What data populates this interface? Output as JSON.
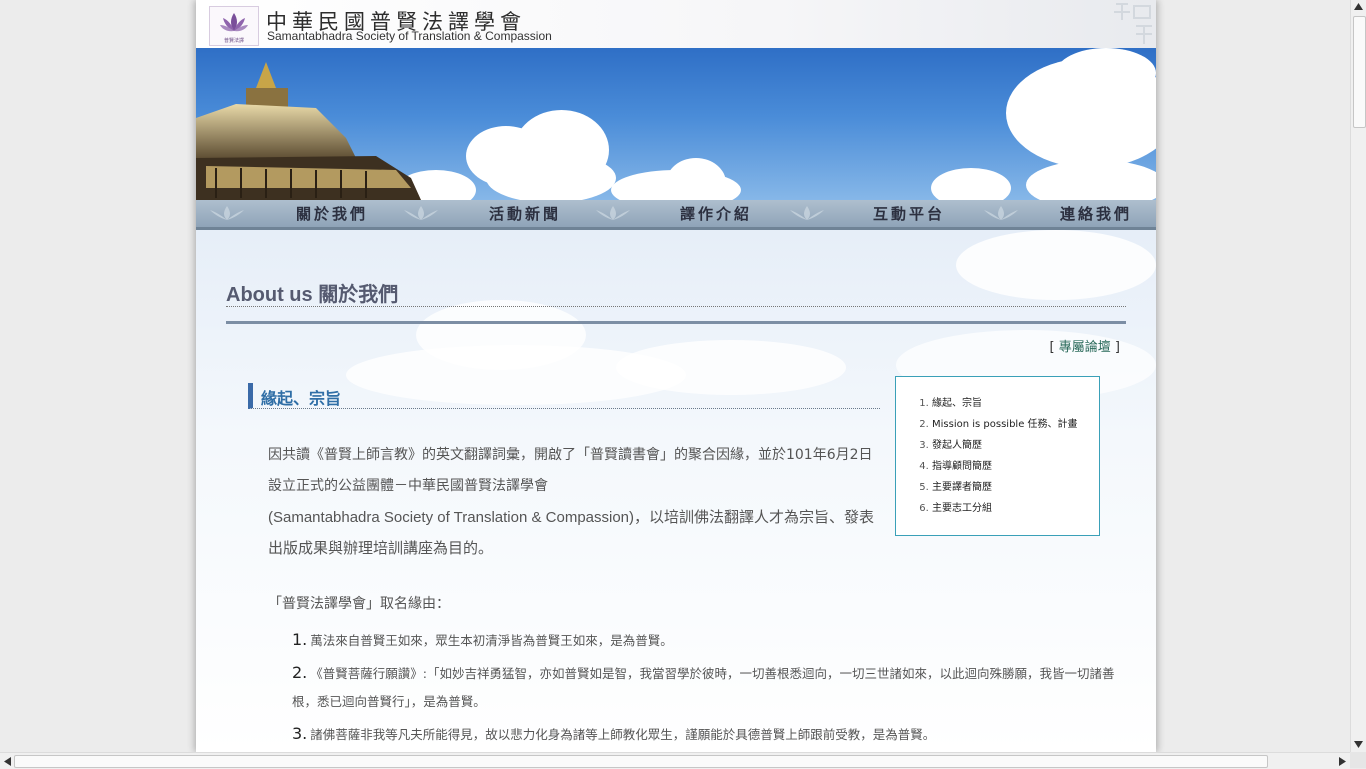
{
  "header": {
    "title_zh": "中華民國普賢法譯學會",
    "title_en": "Samantabhadra Society of Translation & Compassion",
    "logo_caption": "普賢法譯"
  },
  "nav": {
    "items": [
      "關於我們",
      "活動新聞",
      "譯作介紹",
      "互動平台",
      "連絡我們"
    ]
  },
  "page": {
    "title": "About us 關於我們",
    "forum_open": "[",
    "forum_label": "專屬論壇",
    "forum_close": "]"
  },
  "toc": {
    "items": [
      "緣起、宗旨",
      "Mission is possible 任務、計畫",
      "發起人簡歷",
      "指導顧問簡歷",
      "主要譯者簡歷",
      "主要志工分組"
    ]
  },
  "section": {
    "title": "緣起、宗旨",
    "para1": "因共讀《普賢上師言教》的英文翻譯詞彙，開啟了「普賢讀書會」的聚合因緣，並於101年6月2日設立正式的公益團體－中華民國普賢法譯學會",
    "para2": "(Samantabhadra Society of Translation & Compassion)，以培訓佛法翻譯人才為宗旨、發表出版成果與辦理培訓講座為目的。",
    "naming_intro": "「普賢法譯學會」取名緣由：",
    "reasons": [
      {
        "num": "1.",
        "text": "萬法來自普賢王如來，眾生本初清淨皆為普賢王如來，是為普賢。"
      },
      {
        "num": "2.",
        "text": "《普賢菩薩行願讚》:「如妙吉祥勇猛智，亦如普賢如是智，我當習學於彼時，一切善根悉迴向，一切三世諸如來，以此迴向殊勝願，我皆一切諸善根，悉已迴向普賢行」，是為普賢。"
      },
      {
        "num": "3.",
        "text": "諸佛菩薩非我等凡夫所能得見，故以悲力化身為諸等上師教化眾生，謹願能於具德普賢上師跟前受教，是為普賢。"
      }
    ]
  },
  "colors": {
    "accent": "#2f6ea6",
    "rule": "#7c8ea4",
    "toc_border": "#3aa0b8",
    "nav_bg": "#9fb2c4"
  }
}
